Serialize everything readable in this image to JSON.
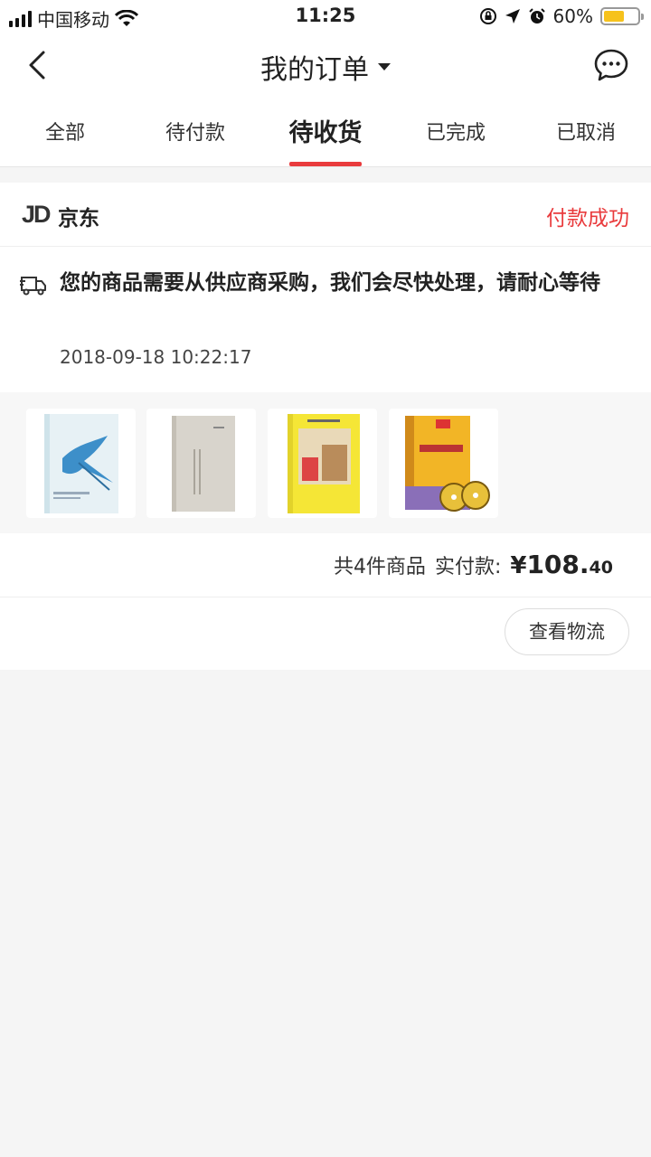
{
  "status_bar": {
    "carrier": "中国移动",
    "time": "11:25",
    "battery_pct": "60%",
    "battery_level": 0.6,
    "icons": [
      "signal-icon",
      "wifi-icon",
      "orientation-lock-icon",
      "location-icon",
      "alarm-icon",
      "battery-icon"
    ]
  },
  "nav": {
    "title": "我的订单",
    "back_icon": "chevron-left-icon",
    "message_icon": "chat-bubble-icon"
  },
  "tabs": [
    {
      "label": "全部",
      "active": false
    },
    {
      "label": "待付款",
      "active": false
    },
    {
      "label": "待收货",
      "active": true
    },
    {
      "label": "已完成",
      "active": false
    },
    {
      "label": "已取消",
      "active": false
    }
  ],
  "order": {
    "shop_logo": "JD",
    "shop_name": "京东",
    "status": "付款成功",
    "notice": "您的商品需要从供应商采购，我们会尽快处理，请耐心等待",
    "notice_time": "2018-09-18 10:22:17",
    "products": [
      "book-cover-blue-bird",
      "book-cover-grey",
      "book-cover-yellow",
      "book-cover-japanese-with-cds"
    ],
    "count_text": "共4件商品",
    "paid_label": "实付款:",
    "price_symbol": "¥",
    "price_int": "108.",
    "price_dec": "40",
    "action_button": "查看物流"
  },
  "colors": {
    "accent_red": "#e93b3d",
    "background": "#f5f5f5"
  }
}
